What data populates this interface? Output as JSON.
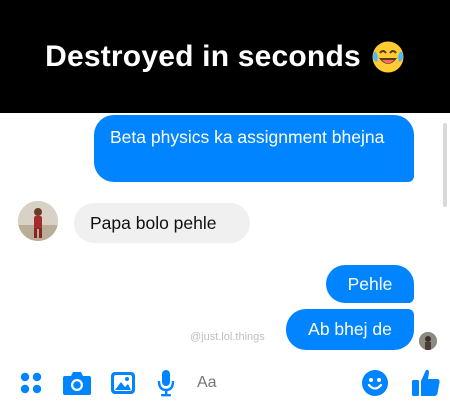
{
  "header": {
    "title": "Destroyed in seconds",
    "emoji": "face-with-tears-of-joy-icon"
  },
  "messages": [
    {
      "sender": "me",
      "text": "Beta physics ka assignment bhejna"
    },
    {
      "sender": "papa",
      "text": "Papa bolo pehle"
    },
    {
      "sender": "me",
      "text": "Pehle"
    },
    {
      "sender": "me",
      "text": "Ab bhej de"
    }
  ],
  "watermark": "@just.lol.things",
  "composer": {
    "placeholder": "Aa",
    "icons": [
      "more-apps-icon",
      "camera-icon",
      "gallery-icon",
      "microphone-icon",
      "emoji-icon",
      "thumbs-up-icon"
    ]
  },
  "colors": {
    "accent": "#0084ff",
    "incoming_bubble": "#f0f0f0",
    "header_bg": "#000000"
  }
}
